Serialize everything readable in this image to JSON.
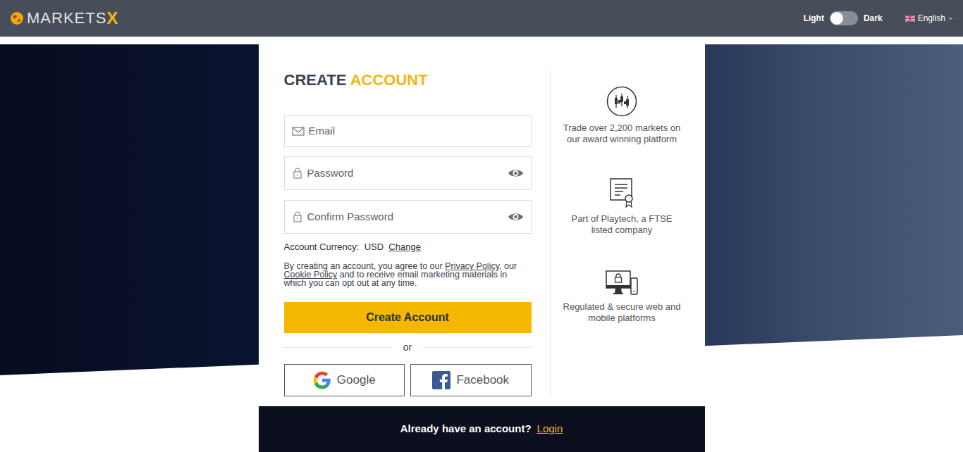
{
  "header": {
    "logo": {
      "prefix": "MARKETS",
      "suffix": "X"
    },
    "theme_toggle": {
      "light_label": "Light",
      "dark_label": "Dark",
      "on": false
    },
    "language": {
      "label": "English"
    }
  },
  "form": {
    "title": {
      "first": "CREATE",
      "second": "ACCOUNT"
    },
    "fields": [
      {
        "placeholder": "Email",
        "kind": "email"
      },
      {
        "placeholder": "Password",
        "kind": "password"
      },
      {
        "placeholder": "Confirm Password",
        "kind": "password"
      }
    ],
    "currency": {
      "label": "Account Currency:",
      "value": "USD",
      "change": "Change"
    },
    "terms": [
      {
        "text": "By creating an account, you agree to our ",
        "kind": "text"
      },
      {
        "text": "Privacy Policy",
        "kind": "link"
      },
      {
        "text": ", our ",
        "kind": "text"
      },
      {
        "text": "Cookie Policy",
        "kind": "link"
      },
      {
        "text": " and to receive email marketing materials in which you can opt out at any time.",
        "kind": "text"
      }
    ],
    "submit": "Create Account",
    "divider": "or",
    "social": [
      {
        "label": "Google",
        "kind": "google"
      },
      {
        "label": "Facebook",
        "kind": "facebook"
      }
    ]
  },
  "features": [
    {
      "text": "Trade over 2,200 markets on our award winning platform",
      "kind": "markets"
    },
    {
      "text": "Part of Playtech, a FTSE listed company",
      "kind": "certificate"
    },
    {
      "text": "Regulated & secure web and mobile platforms",
      "kind": "devices"
    }
  ],
  "footer": {
    "question": "Already have an account?",
    "link": "Login"
  }
}
